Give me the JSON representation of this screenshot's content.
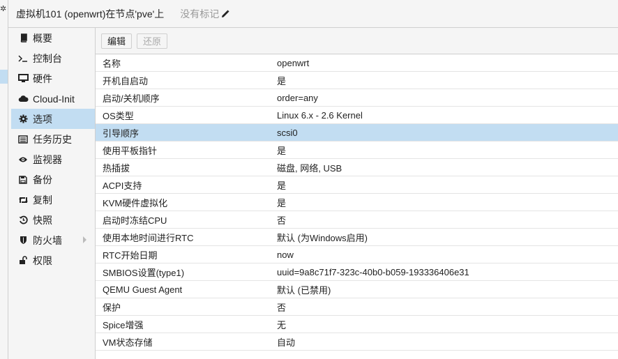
{
  "header": {
    "title": "虚拟机101 (openwrt)在节点'pve'上",
    "tags_label": "没有标记"
  },
  "sidebar": {
    "items": [
      {
        "label": "概要",
        "icon": "book-icon"
      },
      {
        "label": "控制台",
        "icon": "terminal-icon"
      },
      {
        "label": "硬件",
        "icon": "desktop-icon"
      },
      {
        "label": "Cloud-Init",
        "icon": "cloud-icon"
      },
      {
        "label": "选项",
        "icon": "gear-icon",
        "selected": true
      },
      {
        "label": "任务历史",
        "icon": "list-icon"
      },
      {
        "label": "监视器",
        "icon": "eye-icon"
      },
      {
        "label": "备份",
        "icon": "floppy-icon"
      },
      {
        "label": "复制",
        "icon": "retweet-icon"
      },
      {
        "label": "快照",
        "icon": "history-icon"
      },
      {
        "label": "防火墙",
        "icon": "shield-icon",
        "has_submenu": true
      },
      {
        "label": "权限",
        "icon": "unlock-icon"
      }
    ]
  },
  "toolbar": {
    "edit_label": "编辑",
    "revert_label": "还原"
  },
  "options": {
    "rows": [
      {
        "name": "名称",
        "value": "openwrt"
      },
      {
        "name": "开机自启动",
        "value": "是"
      },
      {
        "name": "启动/关机顺序",
        "value": "order=any"
      },
      {
        "name": "OS类型",
        "value": "Linux 6.x - 2.6 Kernel"
      },
      {
        "name": "引导顺序",
        "value": "scsi0",
        "selected": true
      },
      {
        "name": "使用平板指针",
        "value": "是"
      },
      {
        "name": "热插拔",
        "value": "磁盘, 网络, USB"
      },
      {
        "name": "ACPI支持",
        "value": "是"
      },
      {
        "name": "KVM硬件虚拟化",
        "value": "是"
      },
      {
        "name": "启动时冻结CPU",
        "value": "否"
      },
      {
        "name": "使用本地时间进行RTC",
        "value": "默认 (为Windows启用)"
      },
      {
        "name": "RTC开始日期",
        "value": "now"
      },
      {
        "name": "SMBIOS设置(type1)",
        "value": "uuid=9a8c71f7-323c-40b0-b059-193336406e31"
      },
      {
        "name": "QEMU Guest Agent",
        "value": "默认 (已禁用)"
      },
      {
        "name": "保护",
        "value": "否"
      },
      {
        "name": "Spice增强",
        "value": "无"
      },
      {
        "name": "VM状态存储",
        "value": "自动"
      }
    ]
  },
  "colors": {
    "selection": "#c2ddf2",
    "panel_bg": "#f5f5f5",
    "border": "#cfcfcf"
  }
}
